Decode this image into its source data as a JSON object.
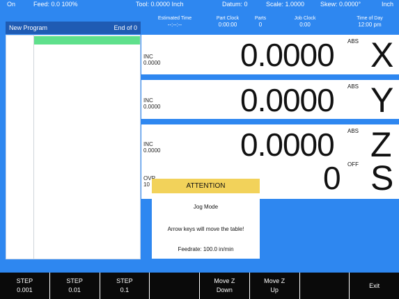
{
  "status_bar": {
    "power": "On",
    "feed": "Feed:  0.0 100%",
    "tool": "Tool: 0.0000 Inch",
    "datum": "Datum: 0",
    "scale": "Scale: 1.0000",
    "skew": "Skew: 0.0000°",
    "units": "Inch"
  },
  "program": {
    "name": "New Program",
    "end": "End of 0"
  },
  "job_info": {
    "estimated_time": {
      "label": "Estimated Time",
      "value": "--:--:--"
    },
    "part_clock": {
      "label": "Part Clock",
      "value": "0:00:00"
    },
    "parts": {
      "label": "Parts",
      "value": "0"
    },
    "job_clock": {
      "label": "Job Clock",
      "value": "0:00"
    },
    "time_of_day": {
      "label": "Time of Day",
      "value": "12:00 pm"
    }
  },
  "axes": [
    {
      "axis": "X",
      "inc_label": "INC",
      "inc_value": "0.0000",
      "value": "0.0000",
      "mode": "ABS"
    },
    {
      "axis": "Y",
      "inc_label": "INC",
      "inc_value": "0.0000",
      "value": "0.0000",
      "mode": "ABS"
    },
    {
      "axis": "Z",
      "inc_label": "INC",
      "inc_value": "0.0000",
      "value": "0.0000",
      "mode": "ABS"
    },
    {
      "axis": "S",
      "inc_label": "OVR",
      "inc_value": "10",
      "value": "0",
      "mode": "OFF"
    }
  ],
  "dialog": {
    "title": "ATTENTION",
    "mode": "Jog Mode",
    "message": "Arrow keys will move the table!",
    "feedrate": "Feedrate: 100.0 in/min"
  },
  "softkeys": [
    {
      "line1": "STEP",
      "line2": "0.001"
    },
    {
      "line1": "STEP",
      "line2": "0.01"
    },
    {
      "line1": "STEP",
      "line2": "0.1"
    },
    {
      "line1": "",
      "line2": ""
    },
    {
      "line1": "Move Z",
      "line2": "Down"
    },
    {
      "line1": "Move Z",
      "line2": "Up"
    },
    {
      "line1": "",
      "line2": ""
    },
    {
      "line1": "Exit",
      "line2": ""
    }
  ]
}
